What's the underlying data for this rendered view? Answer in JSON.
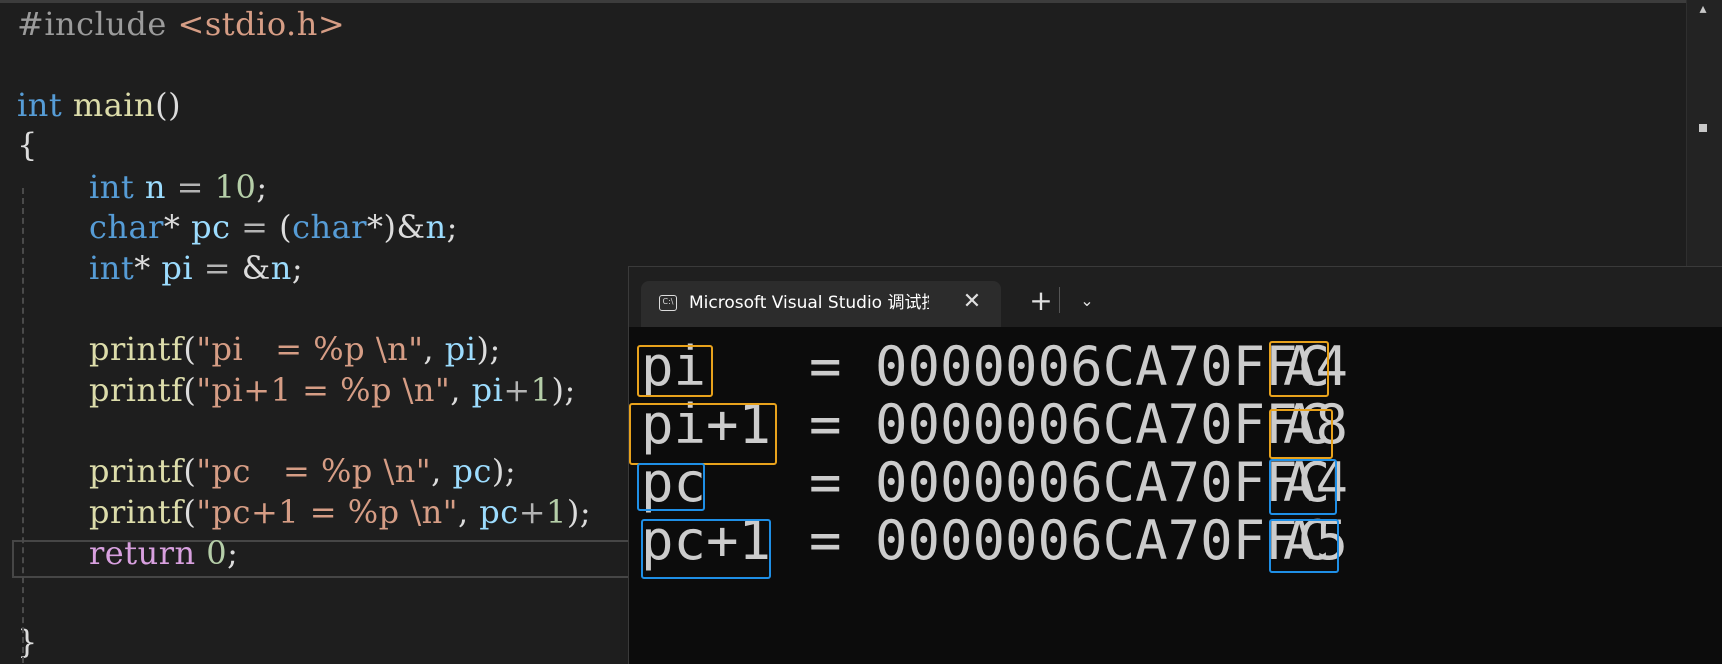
{
  "editor": {
    "lines": [
      {
        "id": "l1"
      },
      {
        "id": "l2"
      }
    ],
    "include_directive": "#include",
    "include_header": "<stdio.h>",
    "kw_int": "int",
    "main_name": "main",
    "parens": "()",
    "open_brace": "{",
    "close_brace": "}",
    "decl_n": {
      "type": "int",
      "name": "n",
      "eq": "=",
      "value": "10",
      "semi": ";"
    },
    "decl_pc": {
      "type": "char",
      "star": "*",
      "name": "pc",
      "eq": "=",
      "cast_open": "(",
      "cast_type": "char",
      "cast_close": "*)",
      "amp": "&",
      "target": "n",
      "semi": ";"
    },
    "decl_pi": {
      "type": "int",
      "star": "*",
      "name": "pi",
      "eq": "=",
      "amp": "&",
      "target": "n",
      "semi": ";"
    },
    "printf_name": "printf",
    "calls": [
      {
        "fmt": "\"pi   = %p \\n\"",
        "arg": "pi",
        "op": "",
        "lit": ""
      },
      {
        "fmt": "\"pi+1 = %p \\n\"",
        "arg": "pi",
        "op": "+",
        "lit": "1"
      },
      {
        "fmt": "\"pc   = %p \\n\"",
        "arg": "pc",
        "op": "",
        "lit": ""
      },
      {
        "fmt": "\"pc+1 = %p \\n\"",
        "arg": "pc",
        "op": "+",
        "lit": "1"
      }
    ],
    "return_kw": "return",
    "return_val": "0",
    "semi": ";"
  },
  "terminal": {
    "tab_title": "Microsoft Visual Studio 调试控制台",
    "tab_icon_text": "C:\\",
    "close_glyph": "✕",
    "new_tab_glyph": "+",
    "dropdown_glyph": "⌄",
    "output": [
      {
        "label": "pi",
        "eq": "=",
        "addr_prefix": "0000006CA70FFC",
        "addr_tail": "A4",
        "color": "orange"
      },
      {
        "label": "pi+1",
        "eq": "=",
        "addr_prefix": "0000006CA70FFC",
        "addr_tail": "A8",
        "color": "orange"
      },
      {
        "label": "pc",
        "eq": "=",
        "addr_prefix": "0000006CA70FFC",
        "addr_tail": "A4",
        "color": "blue"
      },
      {
        "label": "pc+1",
        "eq": "=",
        "addr_prefix": "0000006CA70FFC",
        "addr_tail": "A5",
        "color": "blue"
      }
    ]
  },
  "colors": {
    "highlight_orange": "#e8a21c",
    "highlight_blue": "#1f8fe6",
    "editor_bg": "#1e1e1e",
    "terminal_bg": "#0c0c0c"
  }
}
